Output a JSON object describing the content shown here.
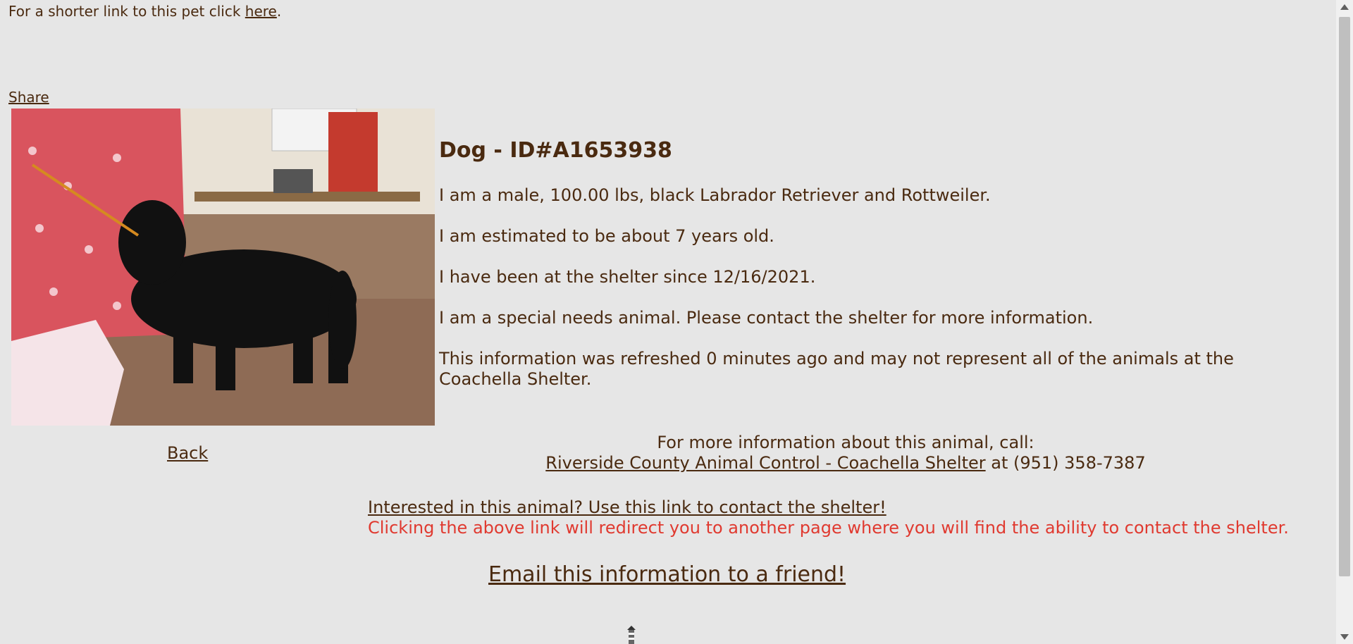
{
  "top": {
    "shortlink_prefix": "For a shorter link to this pet click ",
    "shortlink_link": "here",
    "shortlink_suffix": ".",
    "share": "Share"
  },
  "animal": {
    "title": "Dog - ID#A1653938",
    "lines": [
      "I am a male, 100.00 lbs, black Labrador Retriever and Rottweiler.",
      "I am estimated to be about 7 years old.",
      "I have been at the shelter since 12/16/2021.",
      "I am a special needs animal. Please contact the shelter for more information.",
      "This information was refreshed 0 minutes ago and may not represent all of the animals at the Coachella Shelter."
    ]
  },
  "nav": {
    "back": "Back"
  },
  "contact": {
    "call_prompt": "For more information about this animal, call:",
    "shelter_link": "Riverside County Animal Control - Coachella Shelter",
    "phone_text": " at (951) 358-7387",
    "interested_link": "Interested in this animal? Use this link to contact the shelter!",
    "redirect_note": "Clicking the above link will redirect you to another page where you will find the ability to contact the shelter.",
    "email_link": "Email this information to a friend!"
  },
  "colors": {
    "text": "#4a2a10",
    "background": "#e6e6e6",
    "warning": "#e03a30"
  }
}
